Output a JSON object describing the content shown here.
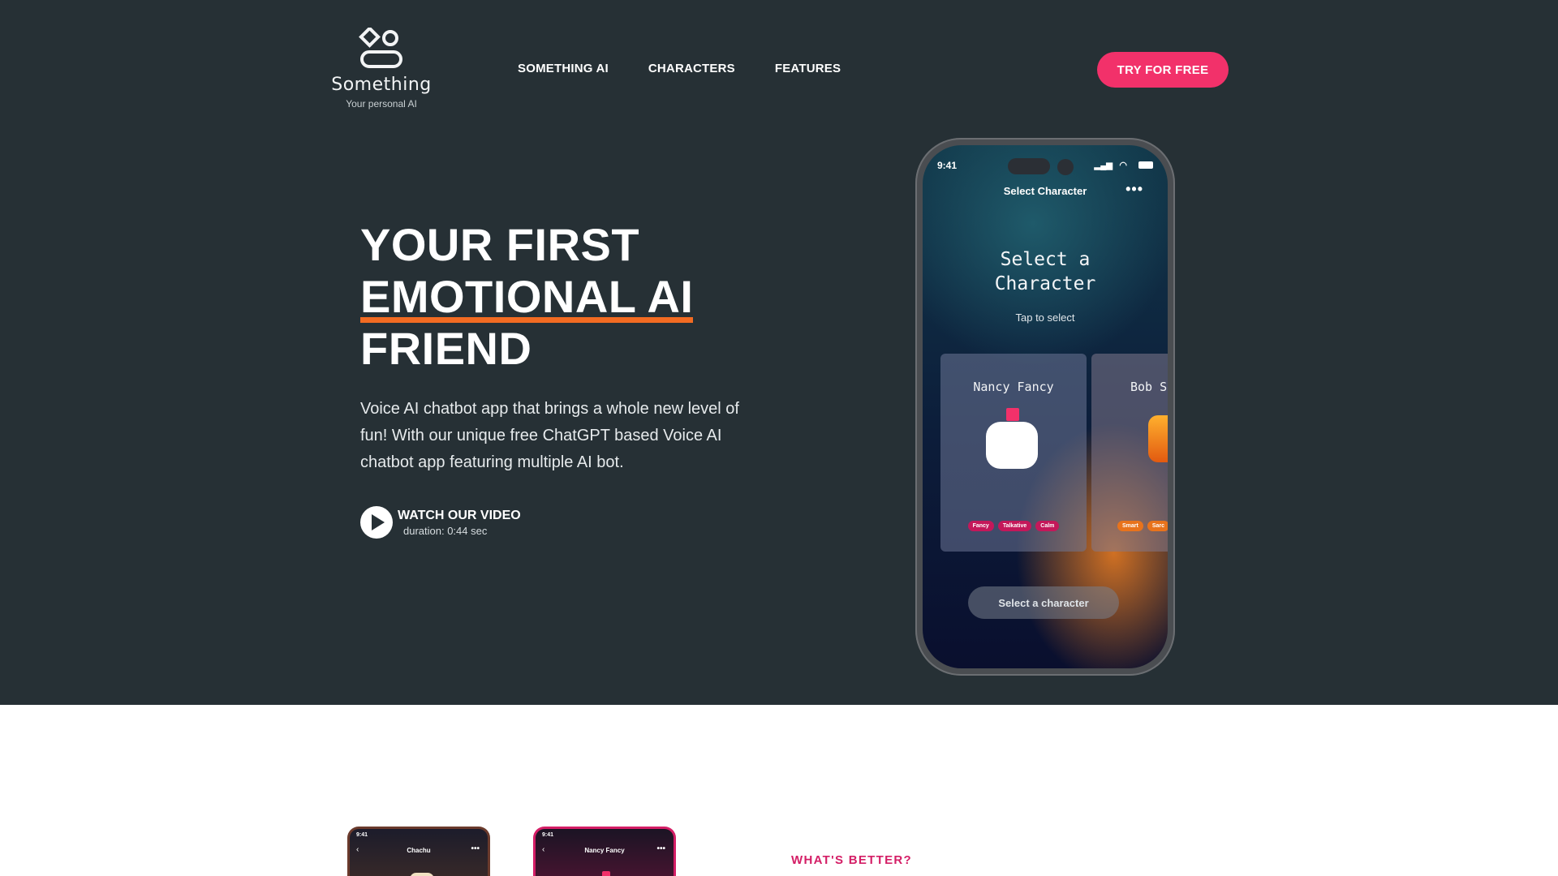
{
  "brand": {
    "name": "Something",
    "tagline": "Your personal AI",
    "logo_icon": "diamond-circle-pill-logo"
  },
  "nav": {
    "items": [
      {
        "label": "SOMETHING AI"
      },
      {
        "label": "CHARACTERS"
      },
      {
        "label": "FEATURES"
      }
    ],
    "cta_label": "TRY FOR FREE"
  },
  "hero": {
    "headline_line1": "YOUR FIRST",
    "headline_line2": "EMOTIONAL AI",
    "headline_line3": "FRIEND",
    "subtext": "Voice AI chatbot app that brings a whole new level of fun! With our unique free ChatGPT based Voice AI chatbot app featuring multiple AI bot.",
    "watch_label": "WATCH OUR VIDEO",
    "watch_duration": "duration: 0:44 sec"
  },
  "phone": {
    "time": "9:41",
    "header_title": "Select Character",
    "big_title_line1": "Select a",
    "big_title_line2": "Character",
    "tap_hint": "Tap to select",
    "cards": [
      {
        "name": "Nancy Fancy",
        "tags": [
          "Fancy",
          "Talkative",
          "Calm"
        ]
      },
      {
        "name": "Bob S",
        "tags": [
          "Smart",
          "Sarc"
        ]
      }
    ],
    "select_button": "Select a character"
  },
  "lower": {
    "mini_phones": [
      {
        "time": "9:41",
        "title": "Chachu"
      },
      {
        "time": "9:41",
        "title": "Nancy Fancy"
      }
    ],
    "kicker": "WHAT'S BETTER?"
  },
  "colors": {
    "hero_bg": "#263035",
    "accent_pink": "#f2316a",
    "underline_orange": "#f26b22",
    "kicker_pink": "#d41e66"
  }
}
